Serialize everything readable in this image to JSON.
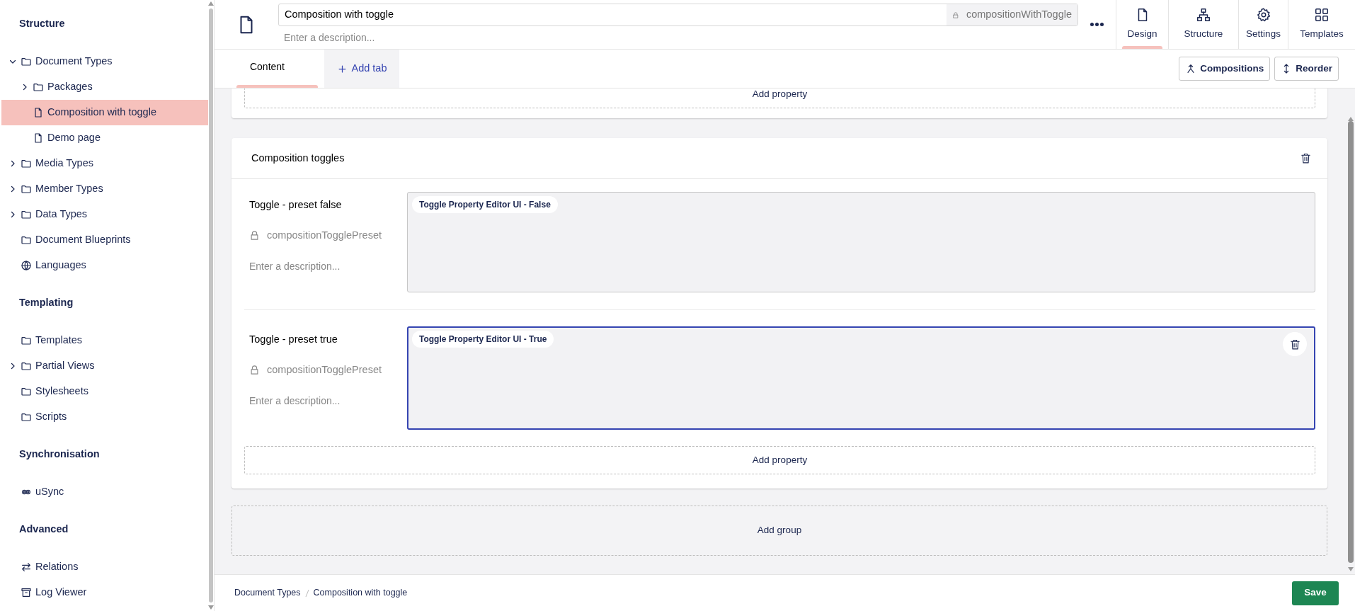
{
  "sidebar": {
    "sections": [
      {
        "heading": "Structure",
        "items": [
          {
            "label": "Document Types",
            "kind": "folder",
            "expandable": true,
            "expanded": true,
            "selected": false,
            "children": [
              {
                "label": "Packages",
                "kind": "folder",
                "expandable": true,
                "expanded": false,
                "selected": false
              },
              {
                "label": "Composition with toggle",
                "kind": "document",
                "expandable": false,
                "selected": true
              },
              {
                "label": "Demo page",
                "kind": "document",
                "expandable": false,
                "selected": false
              }
            ]
          },
          {
            "label": "Media Types",
            "kind": "folder",
            "expandable": true,
            "expanded": false,
            "selected": false
          },
          {
            "label": "Member Types",
            "kind": "folder",
            "expandable": true,
            "expanded": false,
            "selected": false
          },
          {
            "label": "Data Types",
            "kind": "folder",
            "expandable": true,
            "expanded": false,
            "selected": false
          },
          {
            "label": "Document Blueprints",
            "kind": "folder",
            "expandable": false,
            "selected": false
          },
          {
            "label": "Languages",
            "kind": "globe",
            "expandable": false,
            "selected": false
          }
        ]
      },
      {
        "heading": "Templating",
        "items": [
          {
            "label": "Templates",
            "kind": "folder",
            "expandable": false,
            "selected": false
          },
          {
            "label": "Partial Views",
            "kind": "folder",
            "expandable": true,
            "expanded": false,
            "selected": false
          },
          {
            "label": "Stylesheets",
            "kind": "folder",
            "expandable": false,
            "selected": false
          },
          {
            "label": "Scripts",
            "kind": "folder",
            "expandable": false,
            "selected": false
          }
        ]
      },
      {
        "heading": "Synchronisation",
        "items": [
          {
            "label": "uSync",
            "kind": "rings",
            "expandable": false,
            "selected": false
          }
        ]
      },
      {
        "heading": "Advanced",
        "items": [
          {
            "label": "Relations",
            "kind": "arrows",
            "expandable": false,
            "selected": false
          },
          {
            "label": "Log Viewer",
            "kind": "archive",
            "expandable": false,
            "selected": false
          }
        ]
      }
    ]
  },
  "header": {
    "name": "Composition with toggle",
    "alias": "compositionWithToggle",
    "description_placeholder": "Enter a description...",
    "views": [
      {
        "label": "Design",
        "kind": "document",
        "selected": true
      },
      {
        "label": "Structure",
        "kind": "hierarchy",
        "selected": false
      },
      {
        "label": "Settings",
        "kind": "gear",
        "selected": false
      },
      {
        "label": "Templates",
        "kind": "grid",
        "selected": false
      }
    ]
  },
  "tabs": [
    {
      "label": "Content",
      "selected": true
    }
  ],
  "add_tab": "Add tab",
  "toolbar": [
    {
      "label": "Compositions",
      "kind": "merge"
    },
    {
      "label": "Reorder",
      "kind": "updown"
    }
  ],
  "groups": [
    {
      "add_property": "Add property"
    },
    {
      "title": "Composition toggles",
      "add_property": "Add property",
      "properties": [
        {
          "label": "Toggle - preset false",
          "alias": "compositionTogglePreset",
          "description_placeholder": "Enter a description...",
          "editor": "Toggle Property Editor UI - False",
          "selected": false
        },
        {
          "label": "Toggle - preset true",
          "alias": "compositionTogglePreset",
          "description_placeholder": "Enter a description...",
          "editor": "Toggle Property Editor UI - True",
          "selected": true
        }
      ]
    }
  ],
  "add_group": "Add group",
  "footer": {
    "breadcrumb": [
      "Document Types",
      "Composition with toggle"
    ],
    "save": "Save"
  }
}
